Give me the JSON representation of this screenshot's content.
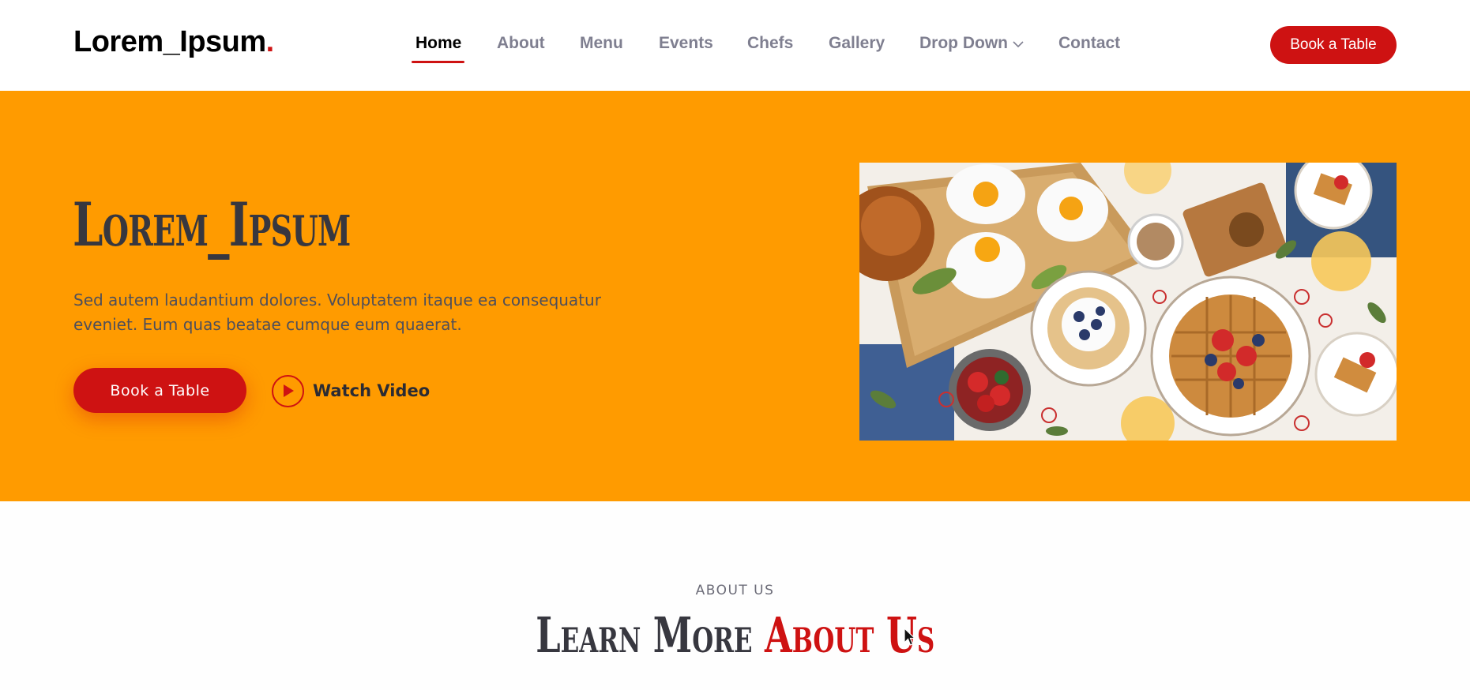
{
  "header": {
    "logo_text": "Lorem_Ipsum",
    "logo_dot": ".",
    "nav": [
      {
        "label": "Home",
        "active": true
      },
      {
        "label": "About"
      },
      {
        "label": "Menu"
      },
      {
        "label": "Events"
      },
      {
        "label": "Chefs"
      },
      {
        "label": "Gallery"
      },
      {
        "label": "Drop Down",
        "icon": "chevron-down-icon"
      },
      {
        "label": "Contact"
      }
    ],
    "cta_label": "Book a Table"
  },
  "hero": {
    "title": "Lorem_Ipsum",
    "text": "Sed autem laudantium dolores. Voluptatem itaque ea consequatur eveniet. Eum quas beatae cumque eum quaerat.",
    "book_label": "Book a Table",
    "watch_label": "Watch Video",
    "image_alt_icon": "food-photo"
  },
  "about": {
    "kicker": "ABOUT US",
    "title_plain": "Learn More",
    "title_accent": "About Us"
  },
  "colors": {
    "accent": "#ce1212",
    "hero_bg": "#ff9b00",
    "nav_text": "#7f7f90"
  }
}
